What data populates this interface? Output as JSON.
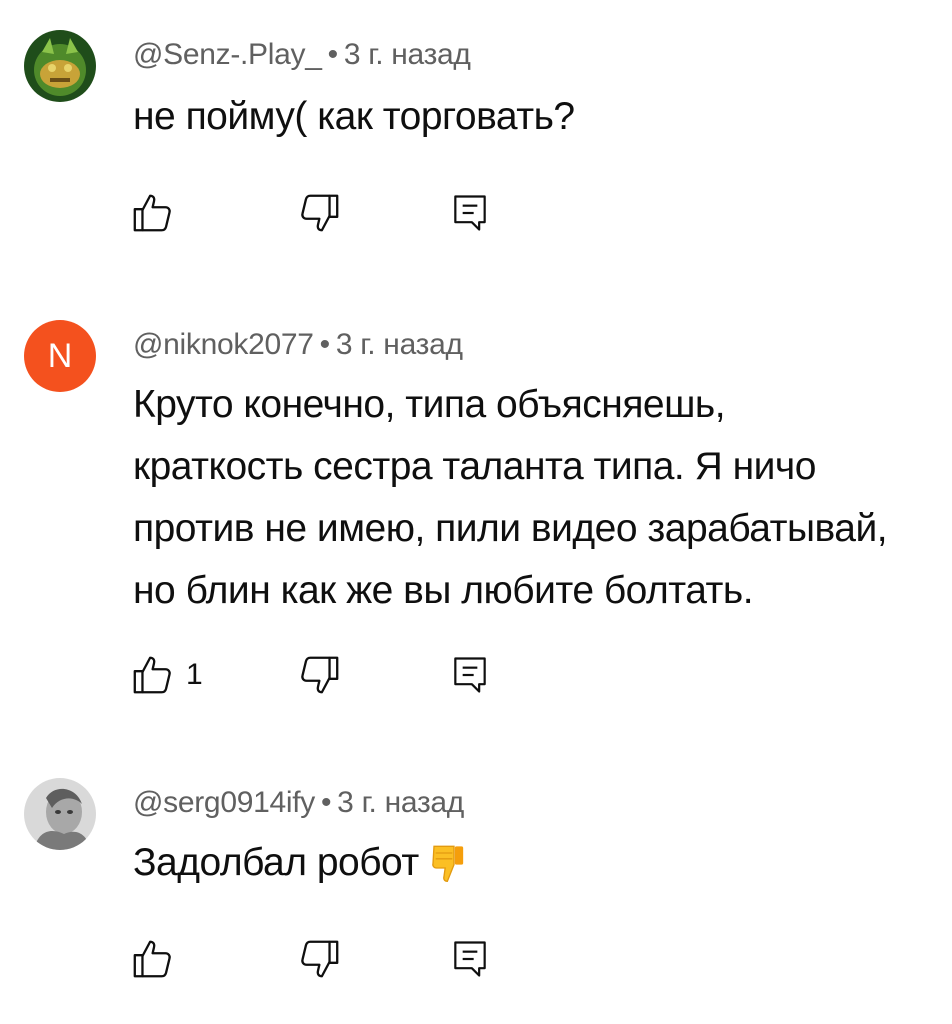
{
  "comments": [
    {
      "author": "@Senz-.Play_",
      "time": "3 г. назад",
      "lines": [
        "не пойму( как торговать?"
      ],
      "likes": "",
      "avatar_icon": "green-creature-avatar-icon"
    },
    {
      "author": "@niknok2077",
      "time": "3 г. назад",
      "avatar_letter": "N",
      "avatar_color": "#f4511e",
      "lines": [
        "Круто конечно, типа объясняешь,",
        "краткость сестра таланта типа. Я ничо",
        "против не имею, пили видео зарабатывай,",
        "но блин как же вы любите болтать."
      ],
      "likes": "1"
    },
    {
      "author": "@serg0914ify",
      "time": "3 г. назад",
      "lines": [
        "Задолбал робот"
      ],
      "emoji": "thumbs-down-emoji",
      "likes": "",
      "avatar_icon": "grey-face-avatar-icon"
    }
  ],
  "separator": "•",
  "icons": {
    "like": "thumbs-up-outline-icon",
    "dislike": "thumbs-down-outline-icon",
    "reply": "reply-comment-icon"
  },
  "colors": {
    "meta": "#606060",
    "text": "#0f0f0f",
    "emoji": "#fbbf24"
  }
}
